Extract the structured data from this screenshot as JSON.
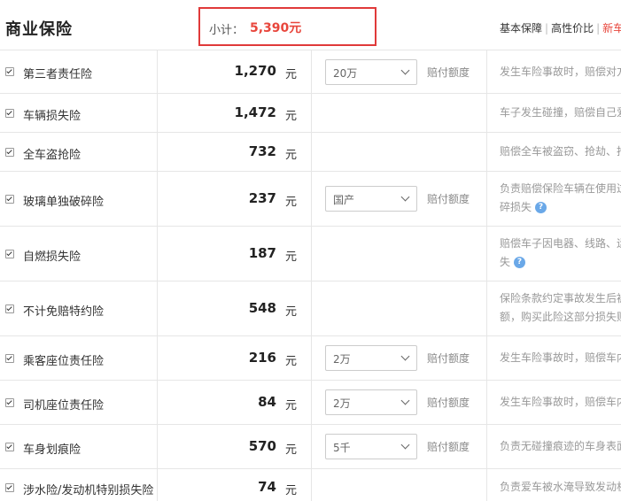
{
  "header": {
    "title": "商业保险",
    "subtotal_label": "小计：",
    "subtotal_value": "5,390元",
    "tabs": [
      "基本保障",
      "高性价比",
      "新车"
    ]
  },
  "unit": "元",
  "coverage_label": "赔付额度",
  "items": [
    {
      "name": "第三者责任险",
      "price": "1,270",
      "select": "20万",
      "desc1": "发生车险事故时，赔偿对方",
      "desc2": ""
    },
    {
      "name": "车辆损失险",
      "price": "1,472",
      "select": "",
      "desc1": "车子发生碰撞，赔偿自己爱",
      "desc2": ""
    },
    {
      "name": "全车盗抢险",
      "price": "732",
      "select": "",
      "desc1": "赔偿全车被盗窃、抢劫、抢",
      "desc2": ""
    },
    {
      "name": "玻璃单独破碎险",
      "price": "237",
      "select": "国产",
      "desc1": "负责赔偿保险车辆在使用过",
      "desc2": "碎损失"
    },
    {
      "name": "自燃损失险",
      "price": "187",
      "select": "",
      "desc1": "赔偿车子因电器、线路、运",
      "desc2": "失"
    },
    {
      "name": "不计免赔特约险",
      "price": "548",
      "select": "",
      "desc1": "保险条款约定事故发生后被",
      "desc2": "额，购买此险这部分损失赔"
    },
    {
      "name": "乘客座位责任险",
      "price": "216",
      "select": "2万",
      "desc1": "发生车险事故时，赔偿车内",
      "desc2": ""
    },
    {
      "name": "司机座位责任险",
      "price": "84",
      "select": "2万",
      "desc1": "发生车险事故时，赔偿车内",
      "desc2": ""
    },
    {
      "name": "车身划痕险",
      "price": "570",
      "select": "5千",
      "desc1": "负责无碰撞痕迹的车身表面",
      "desc2": ""
    },
    {
      "name": "涉水险/发动机特别损失险",
      "price": "74",
      "select": "",
      "desc1": "负责爱车被水淹导致发动机",
      "desc2": ""
    }
  ],
  "colors": {
    "accent": "#e8463c",
    "box_border": "#e03a3a",
    "help": "#6aa8e8"
  }
}
